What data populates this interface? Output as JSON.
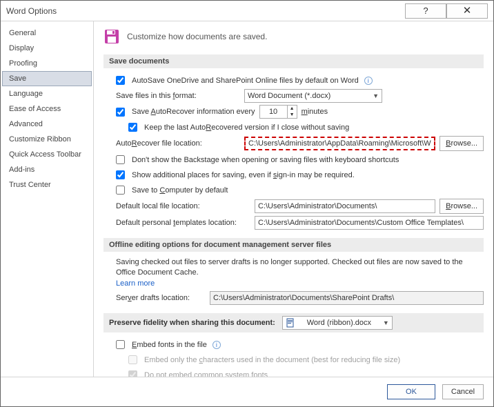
{
  "title": "Word Options",
  "sidebar": {
    "items": [
      {
        "label": "General"
      },
      {
        "label": "Display"
      },
      {
        "label": "Proofing"
      },
      {
        "label": "Save",
        "selected": true
      },
      {
        "label": "Language"
      },
      {
        "label": "Ease of Access"
      },
      {
        "label": "Advanced"
      },
      {
        "label": "Customize Ribbon"
      },
      {
        "label": "Quick Access Toolbar"
      },
      {
        "label": "Add-ins"
      },
      {
        "label": "Trust Center"
      }
    ]
  },
  "header_text": "Customize how documents are saved.",
  "groups": {
    "save_documents": {
      "title": "Save documents",
      "autosave_label": "AutoSave OneDrive and SharePoint Online files by default on Word",
      "format_label": "Save files in this format:",
      "format_value": "Word Document (*.docx)",
      "autorecover_label_a": "Save ",
      "autorecover_label_b": "utoRecover information every",
      "autorecover_minutes": "10",
      "minutes": "minutes",
      "keep_last_label": "Keep the last AutoRecovered version if I close without saving",
      "ar_loc_label": "AutoRecover file location:",
      "ar_loc_value": "C:\\Users\\Administrator\\AppData\\Roaming\\Microsoft\\Word\\",
      "browse": "Browse...",
      "backstage_label": "Don't show the Backstage when opening or saving files with keyboard shortcuts",
      "show_addl_label": "Show additional places for saving, even if sign-in may be required.",
      "save_comp_label": "Save to Computer by default",
      "def_local_label": "Default local file location:",
      "def_local_value": "C:\\Users\\Administrator\\Documents\\",
      "def_tmpl_label": "Default personal templates location:",
      "def_tmpl_value": "C:\\Users\\Administrator\\Documents\\Custom Office Templates\\"
    },
    "offline": {
      "title": "Offline editing options for document management server files",
      "para": "Saving checked out files to server drafts is no longer supported. Checked out files are now saved to the Office Document Cache.",
      "learn_more": "Learn more",
      "drafts_label": "Server drafts location:",
      "drafts_value": "C:\\Users\\Administrator\\Documents\\SharePoint Drafts\\"
    },
    "preserve": {
      "title": "Preserve fidelity when sharing this document:",
      "doc_value": "Word (ribbon).docx",
      "embed_label": "Embed fonts in the file",
      "embed_chars": "Embed only the characters used in the document (best for reducing file size)",
      "embed_sys": "Do not embed common system fonts"
    }
  },
  "footer": {
    "ok": "OK",
    "cancel": "Cancel"
  }
}
